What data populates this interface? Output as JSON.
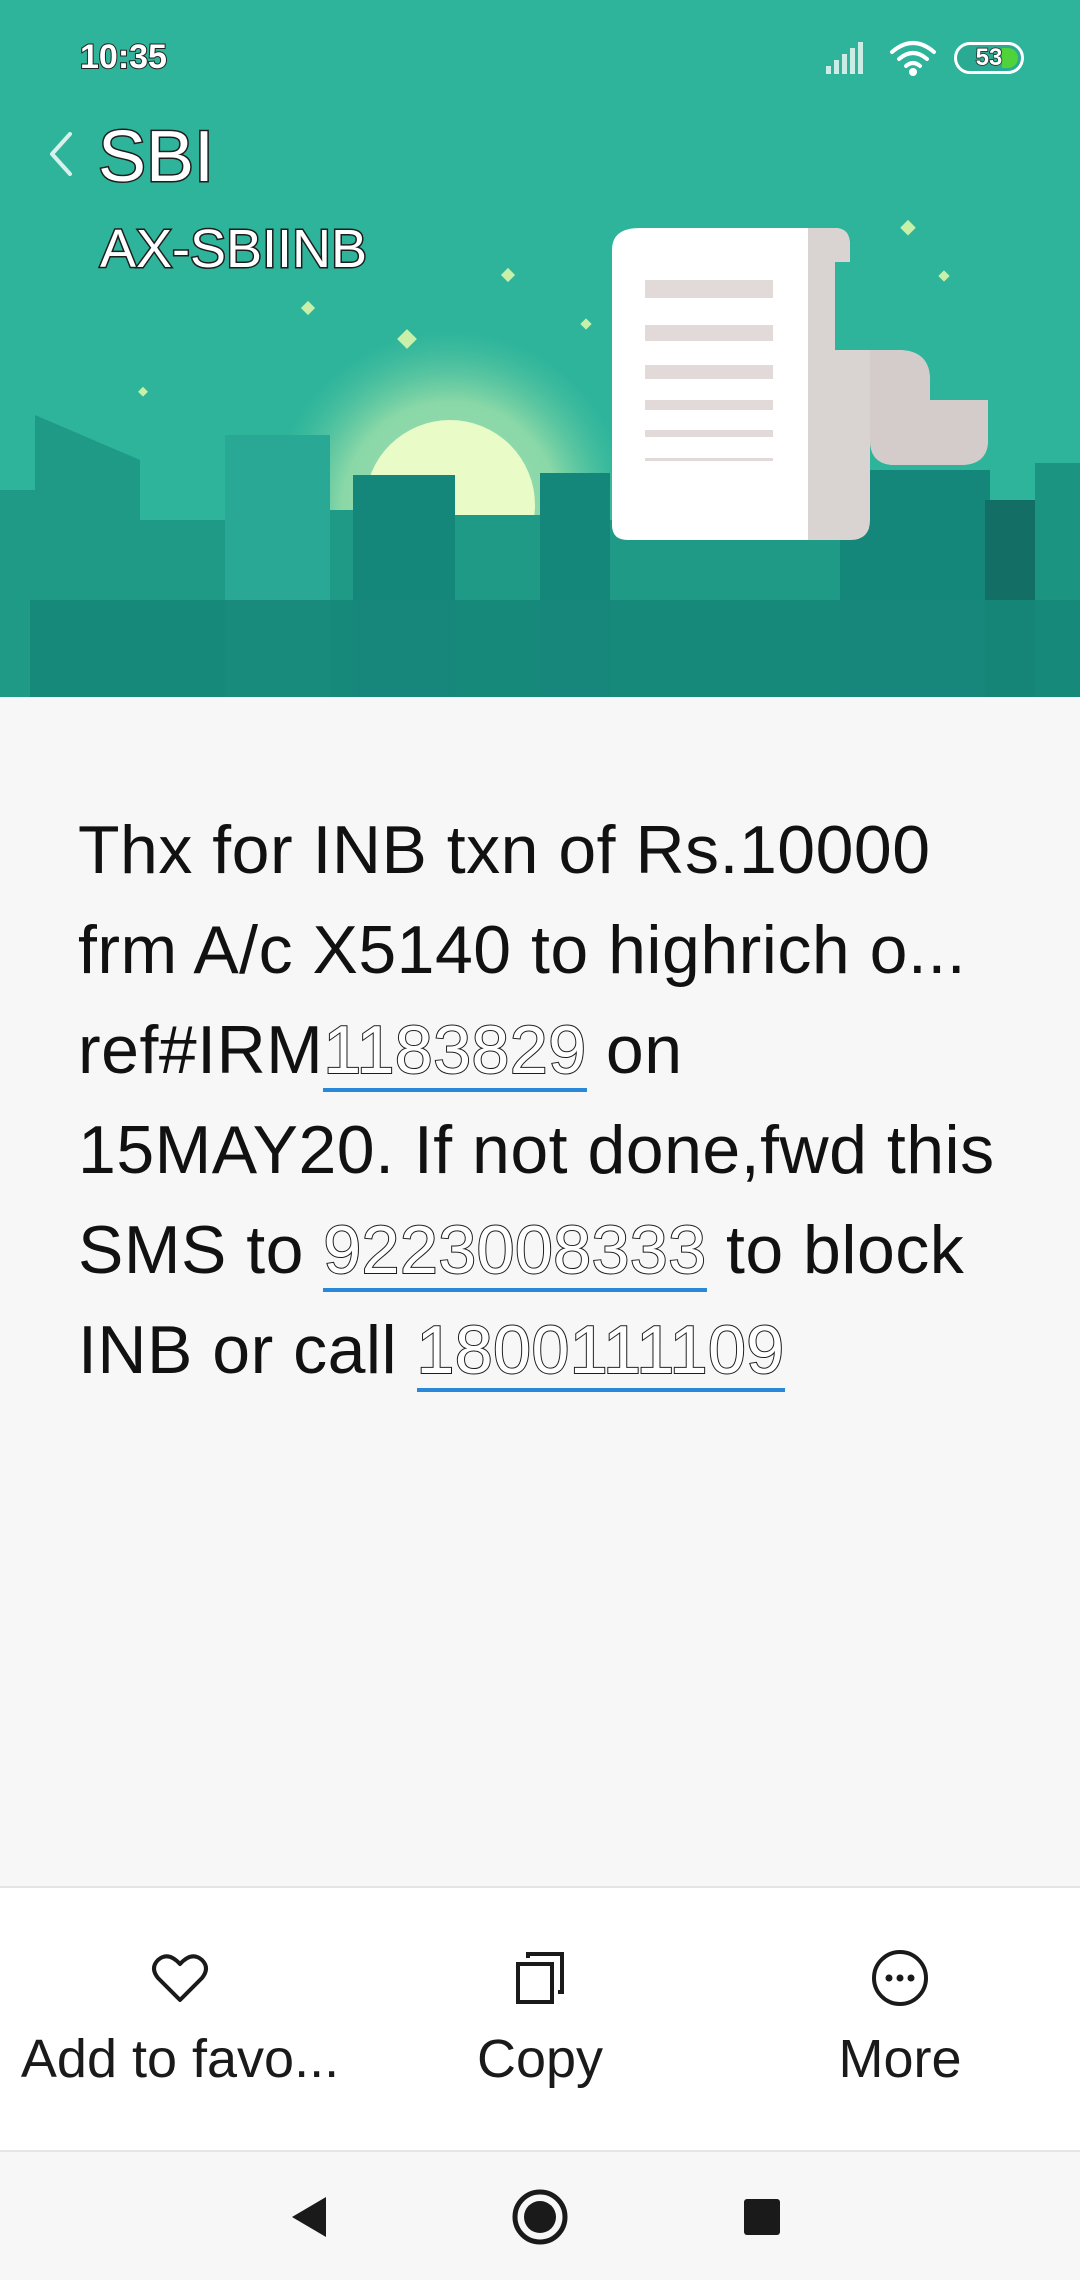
{
  "status_bar": {
    "time": "10:35",
    "battery_level": "53",
    "icons": [
      "signal-icon",
      "wifi-icon",
      "battery-icon"
    ]
  },
  "header": {
    "title": "SBI",
    "sender_id": "AX-SBIINB",
    "back_icon": "chevron-left-icon"
  },
  "message": {
    "segments": [
      {
        "text": "Thx for INB txn of Rs.10000 frm A/c X5140 to highrich o...  ref#IRM",
        "link": false
      },
      {
        "text": "1183829",
        "link": true
      },
      {
        "text": " on 15MAY20.  If not done,fwd this SMS to ",
        "link": false
      },
      {
        "text": "9223008333",
        "link": true
      },
      {
        "text": " to block INB or call ",
        "link": false
      },
      {
        "text": "1800111109",
        "link": true
      }
    ]
  },
  "actions": [
    {
      "label": "Add to favo...",
      "icon": "heart-icon"
    },
    {
      "label": "Copy",
      "icon": "copy-icon"
    },
    {
      "label": "More",
      "icon": "more-icon"
    }
  ],
  "nav": {
    "back": "back-icon",
    "home": "home-icon",
    "recents": "recents-icon"
  },
  "colors": {
    "banner": "#2db49b",
    "link_underline": "#2a88d8"
  }
}
